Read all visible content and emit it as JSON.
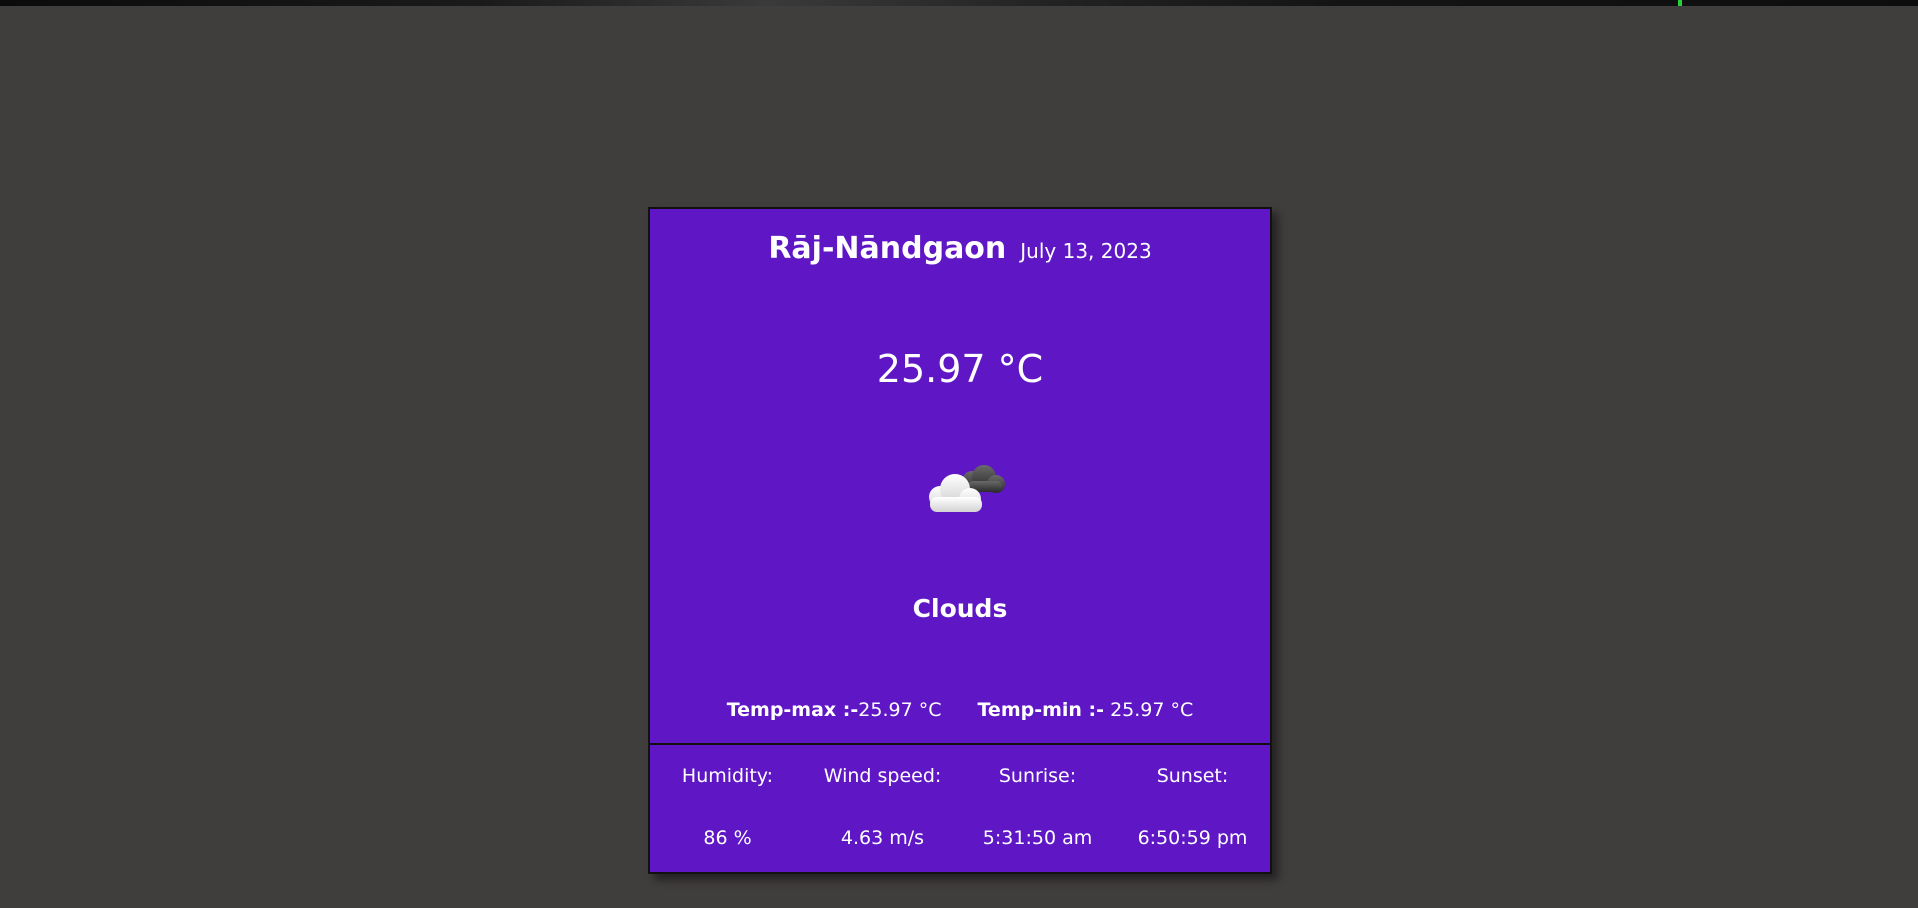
{
  "weather": {
    "city": "Rāj-Nāndgaon",
    "date": "July 13, 2023",
    "temperature": "25.97 °C",
    "condition": "Clouds",
    "icon": "cloud-icon",
    "temp_max_label": "Temp-max :-",
    "temp_max_value": "25.97 °C",
    "temp_min_label": "Temp-min :-",
    "temp_min_value": " 25.97 °C"
  },
  "stats": [
    {
      "label": "Humidity:",
      "value": "86 %"
    },
    {
      "label": "Wind speed:",
      "value": "4.63 m/s"
    },
    {
      "label": "Sunrise:",
      "value": "5:31:50 am"
    },
    {
      "label": "Sunset:",
      "value": "6:50:59 pm"
    }
  ],
  "colors": {
    "background": "#403d3d",
    "card": "#5f17c6",
    "text": "#ffffff",
    "border": "#111111"
  }
}
